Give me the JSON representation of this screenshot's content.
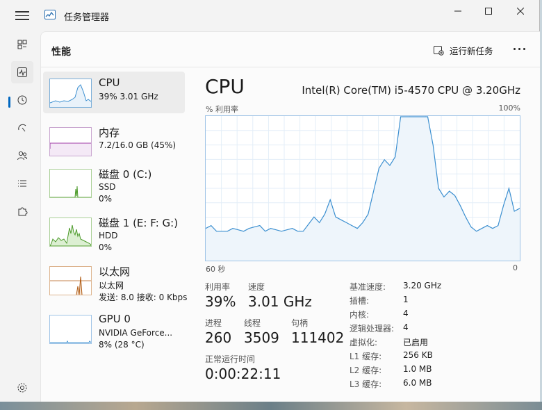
{
  "app": {
    "title": "任务管理器"
  },
  "header": {
    "page_title": "性能",
    "run_new_task": "运行新任务"
  },
  "perf_items": [
    {
      "title": "CPU",
      "sub1": "39%  3.01 GHz",
      "sub2": "",
      "sub3": ""
    },
    {
      "title": "内存",
      "sub1": "7.2/16.0 GB (45%)",
      "sub2": "",
      "sub3": ""
    },
    {
      "title": "磁盘 0 (C:)",
      "sub1": "SSD",
      "sub2": "0%",
      "sub3": ""
    },
    {
      "title": "磁盘 1 (E: F: G:)",
      "sub1": "HDD",
      "sub2": "0%",
      "sub3": ""
    },
    {
      "title": "以太网",
      "sub1": "以太网",
      "sub2": "发送: 8.0  接收: 0 Kbps",
      "sub3": ""
    },
    {
      "title": "GPU 0",
      "sub1": "NVIDIA GeForce...",
      "sub2": "8% (28 °C)",
      "sub3": ""
    }
  ],
  "main": {
    "heading": "CPU",
    "model": "Intel(R) Core(TM) i5-4570 CPU @ 3.20GHz",
    "graph_label_left": "% 利用率",
    "graph_label_right": "100%",
    "axis_left": "60 秒",
    "axis_right": "0",
    "stats": {
      "utilization_label": "利用率",
      "utilization_value": "39%",
      "speed_label": "速度",
      "speed_value": "3.01 GHz",
      "processes_label": "进程",
      "processes_value": "260",
      "threads_label": "线程",
      "threads_value": "3509",
      "handles_label": "句柄",
      "handles_value": "111402",
      "uptime_label": "正常运行时间",
      "uptime_value": "0:00:22:11"
    },
    "specs": [
      {
        "label": "基准速度:",
        "value": "3.20 GHz"
      },
      {
        "label": "插槽:",
        "value": "1"
      },
      {
        "label": "内核:",
        "value": "4"
      },
      {
        "label": "逻辑处理器:",
        "value": "4"
      },
      {
        "label": "虚拟化:",
        "value": "已启用"
      },
      {
        "label": "L1 缓存:",
        "value": "256 KB"
      },
      {
        "label": "L2 缓存:",
        "value": "1.0 MB"
      },
      {
        "label": "L3 缓存:",
        "value": "6.0 MB"
      }
    ]
  },
  "chart_data": {
    "type": "area",
    "x": [
      60,
      59,
      58,
      57,
      56,
      55,
      54,
      53,
      52,
      51,
      50,
      49,
      48,
      47,
      46,
      45,
      44,
      43,
      42,
      41,
      40,
      39,
      38,
      37,
      36,
      35,
      34,
      33,
      32,
      31,
      30,
      29,
      28,
      27,
      26,
      25,
      24,
      23,
      22,
      21,
      20,
      19,
      18,
      17,
      16,
      15,
      14,
      13,
      12,
      11,
      10,
      9,
      8,
      7,
      6,
      5,
      4,
      3,
      2,
      1,
      0
    ],
    "values": [
      22,
      24,
      20,
      20,
      20,
      22,
      21,
      20,
      22,
      23,
      24,
      20,
      22,
      21,
      20,
      21,
      22,
      20,
      20,
      25,
      30,
      26,
      32,
      42,
      30,
      28,
      26,
      24,
      22,
      26,
      32,
      48,
      64,
      70,
      66,
      72,
      100,
      100,
      100,
      100,
      100,
      100,
      80,
      50,
      44,
      48,
      45,
      38,
      30,
      23,
      20,
      22,
      24,
      22,
      24,
      38,
      50,
      34,
      36
    ],
    "ylim": [
      0,
      100
    ],
    "color": "#3b8fd0"
  },
  "colors": {
    "accent": "#0067c0",
    "cpu_line": "#3b8fd0",
    "memory_line": "#a23ea8",
    "disk_line": "#4c9a2a",
    "net_line": "#b05a13"
  }
}
